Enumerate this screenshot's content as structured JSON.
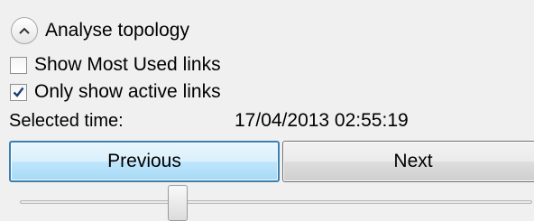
{
  "topology": {
    "header_label": "Analyse topology",
    "expanded": true
  },
  "options": {
    "most_used": {
      "label": "Show Most Used links",
      "checked": false
    },
    "only_active": {
      "label": "Only show active links",
      "checked": true
    }
  },
  "time": {
    "label": "Selected time:",
    "value": "17/04/2013 02:55:19"
  },
  "nav": {
    "previous_label": "Previous",
    "next_label": "Next"
  },
  "colors": {
    "accent": "#3c7fb1",
    "check": "#1f3f7a"
  }
}
